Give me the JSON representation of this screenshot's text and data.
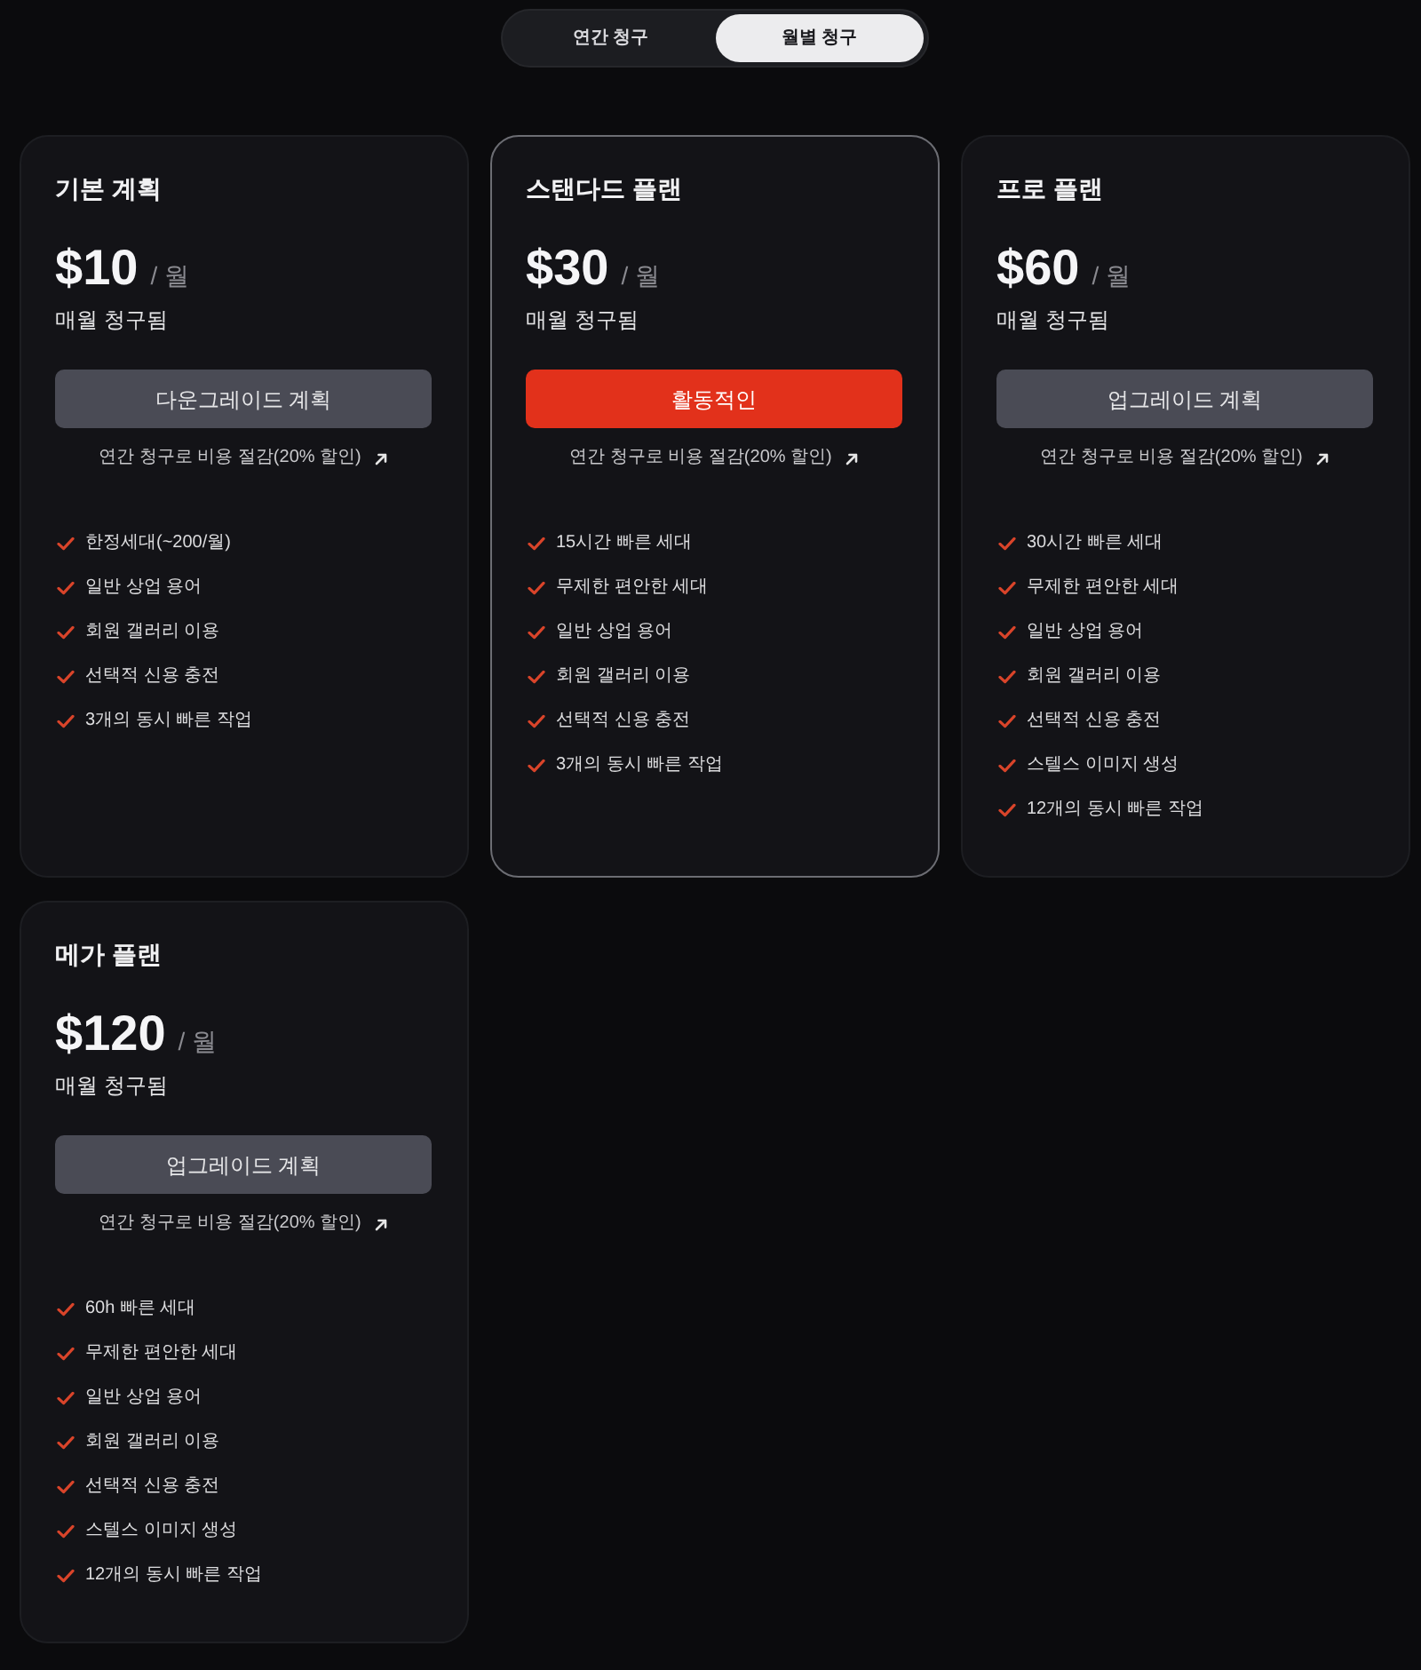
{
  "billing_toggle": {
    "options": [
      {
        "label": "연간 청구",
        "selected": false
      },
      {
        "label": "월별 청구",
        "selected": true
      }
    ]
  },
  "plans": [
    {
      "name": "기본 계획",
      "price": "$10",
      "period": "/ 월",
      "billing_note": "매월 청구됨",
      "current": false,
      "button": {
        "label": "다운그레이드 계획",
        "kind": "secondary"
      },
      "annual_link": "연간 청구로 비용 절감(20% 할인)",
      "features": [
        "한정세대(~200/월)",
        "일반 상업 용어",
        "회원 갤러리 이용",
        "선택적 신용 충전",
        "3개의 동시 빠른 작업"
      ]
    },
    {
      "name": "스탠다드 플랜",
      "price": "$30",
      "period": "/ 월",
      "billing_note": "매월 청구됨",
      "current": true,
      "button": {
        "label": "활동적인",
        "kind": "primary"
      },
      "annual_link": "연간 청구로 비용 절감(20% 할인)",
      "features": [
        "15시간 빠른 세대",
        "무제한 편안한 세대",
        "일반 상업 용어",
        "회원 갤러리 이용",
        "선택적 신용 충전",
        "3개의 동시 빠른 작업"
      ]
    },
    {
      "name": "프로 플랜",
      "price": "$60",
      "period": "/ 월",
      "billing_note": "매월 청구됨",
      "current": false,
      "button": {
        "label": "업그레이드 계획",
        "kind": "secondary"
      },
      "annual_link": "연간 청구로 비용 절감(20% 할인)",
      "features": [
        "30시간 빠른 세대",
        "무제한 편안한 세대",
        "일반 상업 용어",
        "회원 갤러리 이용",
        "선택적 신용 충전",
        "스텔스 이미지 생성",
        "12개의 동시 빠른 작업"
      ]
    },
    {
      "name": "메가 플랜",
      "price": "$120",
      "period": "/ 월",
      "billing_note": "매월 청구됨",
      "current": false,
      "button": {
        "label": "업그레이드 계획",
        "kind": "secondary"
      },
      "annual_link": "연간 청구로 비용 절감(20% 할인)",
      "features": [
        "60h 빠른 세대",
        "무제한 편안한 세대",
        "일반 상업 용어",
        "회원 갤러리 이용",
        "선택적 신용 충전",
        "스텔스 이미지 생성",
        "12개의 동시 빠른 작업"
      ]
    }
  ]
}
